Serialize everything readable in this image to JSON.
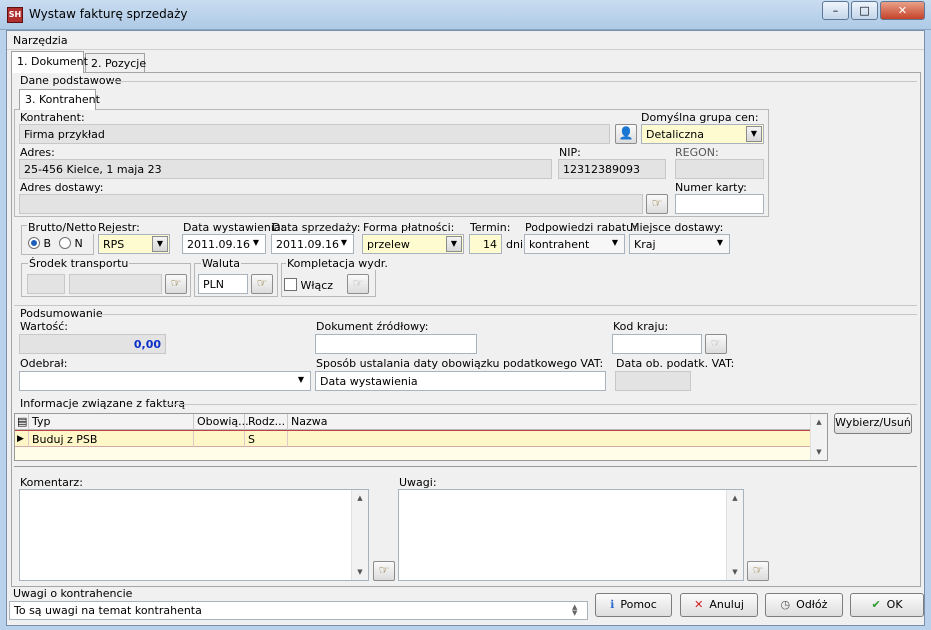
{
  "window": {
    "title": "Wystaw fakturę sprzedaży",
    "min": "–",
    "max": "□",
    "close": "✕"
  },
  "menu": {
    "tools": "Narzędzia"
  },
  "tabs": [
    "1. Dokument",
    "2. Pozycje"
  ],
  "basic": {
    "title": "Dane podstawowe",
    "subtab": "3. Kontrahent",
    "contractor_label": "Kontrahent:",
    "contractor_value": "Firma przykład",
    "price_group_label": "Domyślna grupa cen:",
    "price_group_value": "Detaliczna",
    "address_label": "Adres:",
    "address_value": "25-456 Kielce, 1 maja 23",
    "nip_label": "NIP:",
    "nip_value": "12312389093",
    "regon_label": "REGON:",
    "regon_value": "",
    "delivery_label": "Adres dostawy:",
    "delivery_value": "",
    "card_label": "Numer karty:",
    "card_value": ""
  },
  "params": {
    "gross_label": "Brutto/Netto",
    "radio_b": "B",
    "radio_n": "N",
    "register_label": "Rejestr:",
    "register_value": "RPS",
    "issue_label": "Data wystawienia:",
    "issue_value": "2011.09.16",
    "sale_label": "Data sprzedaży:",
    "sale_value": "2011.09.16",
    "payment_label": "Forma płatności:",
    "payment_value": "przelew",
    "term_label": "Termin:",
    "term_value": "14",
    "term_unit": "dni",
    "discount_label": "Podpowiedzi rabatu:",
    "discount_value": "kontrahent",
    "delivery_place_label": "Miejsce dostawy:",
    "delivery_place_value": "Kraj",
    "transport_label": "Środek transportu",
    "currency_label": "Waluta",
    "currency_value": "PLN",
    "completion_label": "Kompletacja wydr.",
    "completion_check": "Włącz"
  },
  "summary": {
    "title": "Podsumowanie",
    "value_label": "Wartość:",
    "value_value": "0,00",
    "source_doc_label": "Dokument źródłowy:",
    "source_doc_value": "",
    "country_label": "Kod kraju:",
    "country_value": "",
    "received_label": "Odebrał:",
    "received_value": "",
    "vat_method_label": "Sposób ustalania daty obowiązku podatkowego VAT:",
    "vat_method_value": "Data wystawienia",
    "vat_date_label": "Data ob. podatk. VAT:",
    "vat_date_value": ""
  },
  "info": {
    "title": "Informacje związane z fakturą",
    "columns": [
      "Typ",
      "Obowią...",
      "Rodz...",
      "Nazwa"
    ],
    "rows": [
      {
        "typ": "Buduj z PSB",
        "obow": "",
        "rodz": "S",
        "nazwa": ""
      }
    ],
    "select_button": "Wybierz/Usuń"
  },
  "comments": {
    "comment_label": "Komentarz:",
    "notes_label": "Uwagi:"
  },
  "contractor_notes": {
    "label": "Uwagi o kontrahencie",
    "value": "To są uwagi na temat kontrahenta"
  },
  "buttons": {
    "help": "Pomoc",
    "cancel": "Anuluj",
    "defer": "Odłóż",
    "ok": "OK"
  },
  "colors": {
    "required_field": "#fffbd0",
    "readonly_field": "#e3e3e3",
    "value_blue": "#0c2ec8",
    "window_frame": "#b9d1ea"
  }
}
